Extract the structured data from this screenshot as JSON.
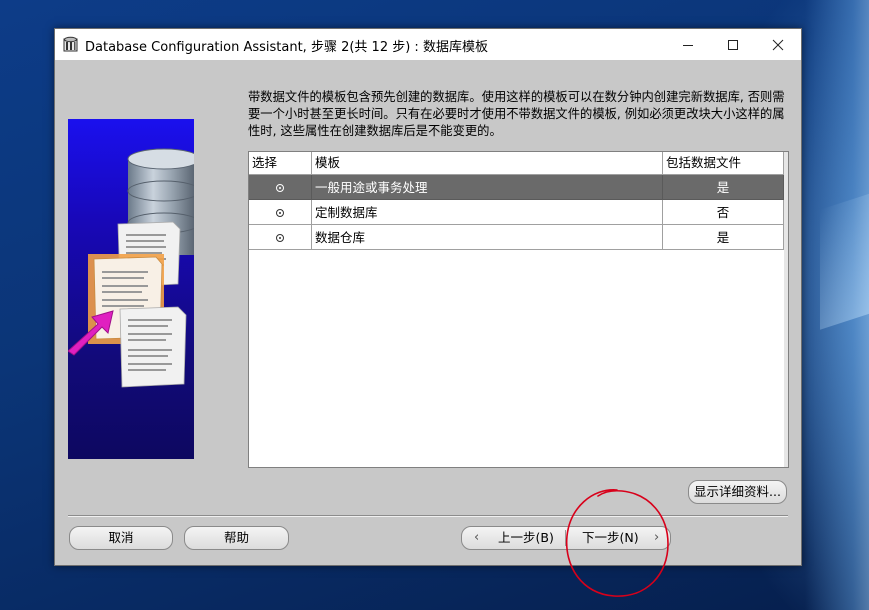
{
  "window": {
    "title": "Database Configuration Assistant, 步骤 2(共 12 步) : 数据库模板"
  },
  "intro_text": "带数据文件的模板包含预先创建的数据库。使用这样的模板可以在数分钟内创建完新数据库, 否则需要一个小时甚至更长时间。只有在必要时才使用不带数据文件的模板, 例如必须更改块大小这样的属性时, 这些属性在创建数据库后是不能变更的。",
  "table": {
    "headers": {
      "select": "选择",
      "template": "模板",
      "includes_datafiles": "包括数据文件"
    },
    "rows": [
      {
        "name": "一般用途或事务处理",
        "includes_datafiles": "是",
        "selected": true
      },
      {
        "name": "定制数据库",
        "includes_datafiles": "否",
        "selected": false
      },
      {
        "name": "数据仓库",
        "includes_datafiles": "是",
        "selected": false
      }
    ]
  },
  "buttons": {
    "show_details": "显示详细资料...",
    "cancel": "取消",
    "help": "帮助",
    "back": "上一步(B)",
    "next": "下一步(N)"
  },
  "icons": {
    "app": "database-app-icon",
    "minimize": "minimize-icon",
    "maximize": "maximize-icon",
    "close": "close-icon",
    "back": "chevron-left-icon",
    "next": "chevron-right-icon"
  },
  "colors": {
    "selected_row": "#6a6a6a",
    "side_panel": "#1808b8",
    "annotation": "#d8001a"
  }
}
